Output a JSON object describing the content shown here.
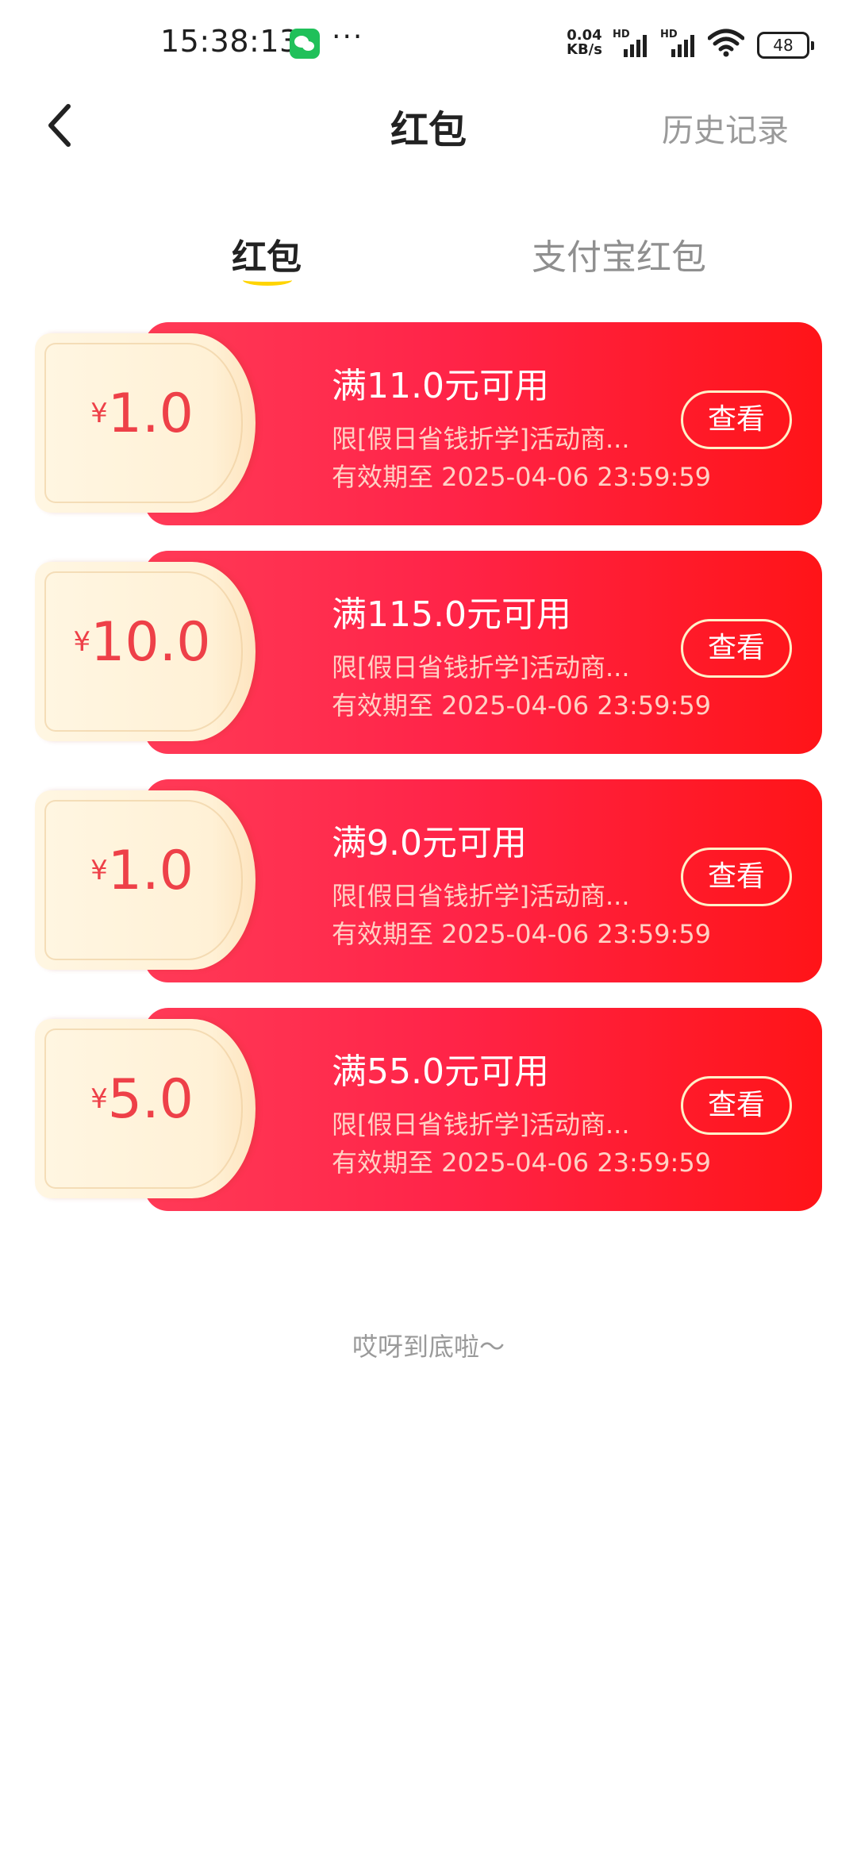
{
  "status_bar": {
    "time": "15:38:13",
    "more": "···",
    "net_speed_value": "0.04",
    "net_speed_unit": "KB/s",
    "signal_label": "HD",
    "battery": "48"
  },
  "nav": {
    "title": "红包",
    "history_label": "历史记录"
  },
  "tabs": [
    {
      "label": "红包",
      "active": true
    },
    {
      "label": "支付宝红包",
      "active": false
    }
  ],
  "coupons": [
    {
      "currency": "¥",
      "amount": "1.0",
      "title": "满11.0元可用",
      "desc": "限[假日省钱折学]活动商...",
      "expire": "有效期至 2025-04-06 23:59:59",
      "button": "查看"
    },
    {
      "currency": "¥",
      "amount": "10.0",
      "title": "满115.0元可用",
      "desc": "限[假日省钱折学]活动商...",
      "expire": "有效期至 2025-04-06 23:59:59",
      "button": "查看"
    },
    {
      "currency": "¥",
      "amount": "1.0",
      "title": "满9.0元可用",
      "desc": "限[假日省钱折学]活动商...",
      "expire": "有效期至 2025-04-06 23:59:59",
      "button": "查看"
    },
    {
      "currency": "¥",
      "amount": "5.0",
      "title": "满55.0元可用",
      "desc": "限[假日省钱折学]活动商...",
      "expire": "有效期至 2025-04-06 23:59:59",
      "button": "查看"
    }
  ],
  "footer": {
    "end_text": "哎呀到底啦～"
  },
  "colors": {
    "accent_red": "#ff1a3c",
    "tab_indicator": "#ffd400",
    "amount_red": "#ee4048"
  }
}
